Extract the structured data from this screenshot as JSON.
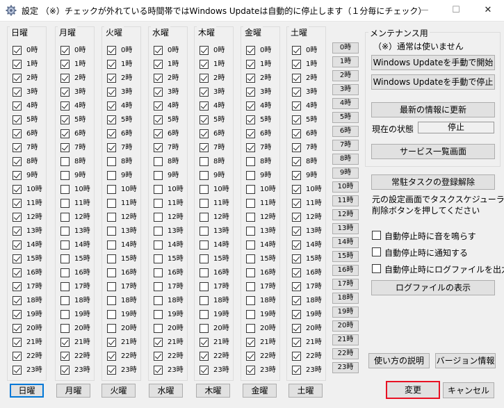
{
  "window": {
    "title": "設定 （※）チェックが外れている時間帯ではWindows Updateは自動的に停止します（１分毎にチェック）",
    "minimize": "—",
    "maximize": "☐",
    "close": "✕"
  },
  "hours": [
    "0時",
    "1時",
    "2時",
    "3時",
    "4時",
    "5時",
    "6時",
    "7時",
    "8時",
    "9時",
    "10時",
    "11時",
    "12時",
    "13時",
    "14時",
    "15時",
    "16時",
    "17時",
    "18時",
    "19時",
    "20時",
    "21時",
    "22時",
    "23時"
  ],
  "days": [
    {
      "name": "日曜",
      "button": "日曜",
      "checked": [
        true,
        true,
        true,
        true,
        true,
        true,
        true,
        true,
        true,
        true,
        true,
        true,
        true,
        true,
        true,
        true,
        true,
        true,
        true,
        true,
        true,
        true,
        true,
        true
      ]
    },
    {
      "name": "月曜",
      "button": "月曜",
      "checked": [
        true,
        true,
        true,
        true,
        true,
        true,
        true,
        true,
        false,
        false,
        false,
        false,
        false,
        false,
        false,
        false,
        false,
        false,
        false,
        false,
        false,
        true,
        true,
        true
      ]
    },
    {
      "name": "火曜",
      "button": "火曜",
      "checked": [
        true,
        true,
        true,
        true,
        true,
        true,
        true,
        true,
        false,
        false,
        false,
        false,
        false,
        false,
        false,
        false,
        false,
        false,
        false,
        false,
        false,
        true,
        true,
        true
      ]
    },
    {
      "name": "水曜",
      "button": "水曜",
      "checked": [
        true,
        true,
        true,
        true,
        true,
        true,
        true,
        true,
        false,
        false,
        false,
        false,
        false,
        false,
        false,
        false,
        false,
        false,
        false,
        false,
        false,
        true,
        true,
        true
      ]
    },
    {
      "name": "木曜",
      "button": "木曜",
      "checked": [
        true,
        true,
        true,
        true,
        true,
        true,
        true,
        true,
        false,
        false,
        false,
        false,
        false,
        false,
        false,
        false,
        false,
        false,
        false,
        false,
        false,
        true,
        true,
        true
      ]
    },
    {
      "name": "金曜",
      "button": "金曜",
      "checked": [
        true,
        true,
        true,
        true,
        true,
        true,
        true,
        true,
        false,
        false,
        false,
        false,
        false,
        false,
        false,
        false,
        false,
        false,
        false,
        false,
        false,
        true,
        true,
        true
      ]
    },
    {
      "name": "土曜",
      "button": "土曜",
      "checked": [
        true,
        true,
        true,
        true,
        true,
        true,
        true,
        true,
        true,
        true,
        true,
        true,
        true,
        true,
        true,
        true,
        true,
        true,
        true,
        true,
        true,
        true,
        true,
        true
      ]
    }
  ],
  "maintenance": {
    "title": "メンテナンス用",
    "note": "（※）通常は使いません",
    "start_update": "Windows Updateを手動で開始",
    "stop_update": "Windows Updateを手動で停止",
    "refresh": "最新の情報に更新",
    "status_label": "現在の状態",
    "status_value": "停止",
    "services": "サービス一覧画面"
  },
  "task": {
    "unregister": "常駐タスクの登録解除",
    "note_line1": "元の設定画面でタスクスケジューラから",
    "note_line2": "削除ボタンを押してください"
  },
  "options": [
    {
      "label": "自動停止時に音を鳴らす",
      "checked": false
    },
    {
      "label": "自動停止時に通知する",
      "checked": false
    },
    {
      "label": "自動停止時にログファイルを出力",
      "checked": false
    }
  ],
  "show_log": "ログファイルの表示",
  "help": "使い方の説明",
  "version": "バージョン情報",
  "apply": "変更",
  "cancel": "キャンセル"
}
